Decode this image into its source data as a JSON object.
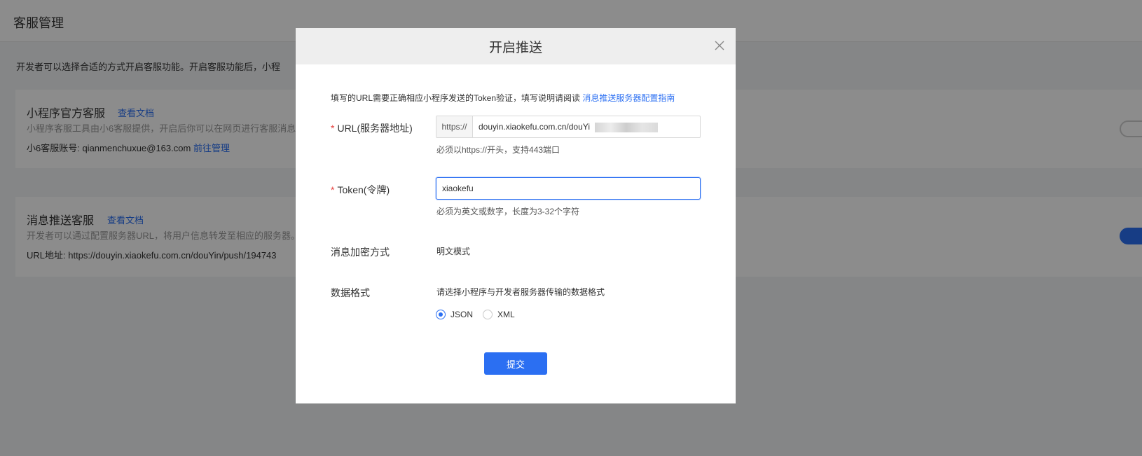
{
  "page": {
    "title": "客服管理",
    "intro": "开发者可以选择合适的方式开启客服功能。开启客服功能后，小程",
    "official": {
      "title": "小程序官方客服",
      "doc_link": "查看文档",
      "desc": "小程序客服工具由小6客服提供，开启后你可以在网页进行客服消息",
      "account_label": "小6客服账号: qianmenchuxue@163.com",
      "manage_link": "前往管理"
    },
    "push": {
      "title": "消息推送客服",
      "doc_link": "查看文档",
      "desc": "开发者可以通过配置服务器URL，将用户信息转发至相应的服务器。",
      "url_info": "URL地址: https://douyin.xiaokefu.com.cn/douYin/push/194743"
    }
  },
  "modal": {
    "title": "开启推送",
    "notice_text": "填写的URL需要正确相应小程序发送的Token验证，填写说明请阅读",
    "notice_link": "消息推送服务器配置指南",
    "url": {
      "label": "URL(服务器地址)",
      "required_mark": "*",
      "prefix": "https://",
      "value": "douyin.xiaokefu.com.cn/douYi",
      "hint": "必须以https://开头，支持443端口"
    },
    "token": {
      "label": "Token(令牌)",
      "required_mark": "*",
      "value": "xiaokefu",
      "hint": "必须为英文或数字，长度为3-32个字符"
    },
    "encryption": {
      "label": "消息加密方式",
      "value": "明文模式"
    },
    "format": {
      "label": "数据格式",
      "desc": "请选择小程序与开发者服务器传输的数据格式",
      "options": [
        "JSON",
        "XML"
      ],
      "selected": "JSON"
    },
    "submit_label": "提交"
  },
  "colors": {
    "accent": "#2b6ff2",
    "required": "#e64340",
    "overlay": "rgba(0,0,0,0.45)"
  }
}
